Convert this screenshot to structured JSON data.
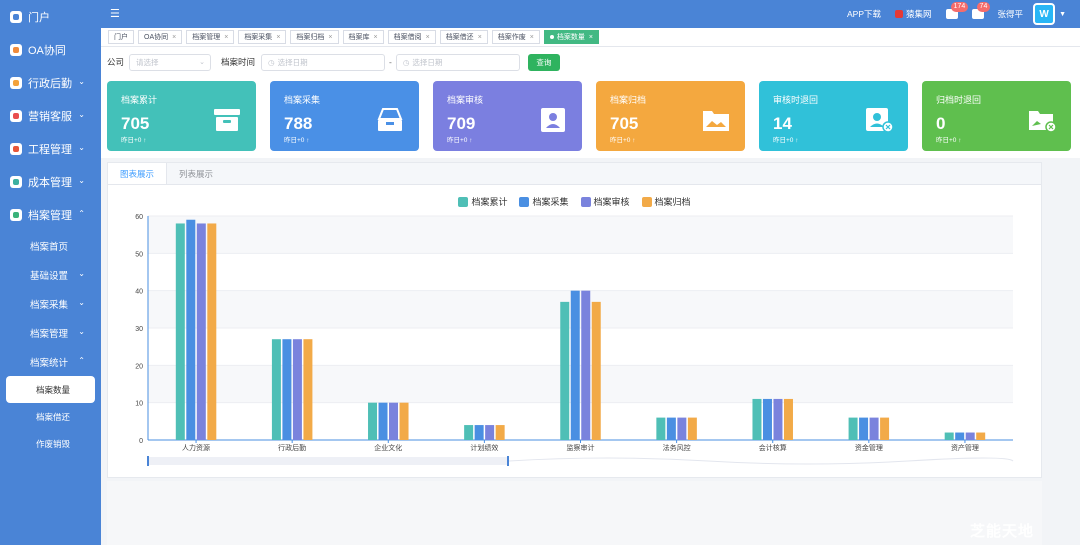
{
  "sidebar": {
    "top_items": [
      {
        "label": "门户",
        "icon": "portal-icon"
      },
      {
        "label": "OA协同",
        "icon": "oa-icon"
      },
      {
        "label": "行政后勤",
        "icon": "admin-icon"
      },
      {
        "label": "营销客服",
        "icon": "marketing-icon"
      },
      {
        "label": "工程管理",
        "icon": "engineering-icon"
      },
      {
        "label": "成本管理",
        "icon": "cost-icon"
      },
      {
        "label": "档案管理",
        "icon": "archive-icon"
      }
    ],
    "archive_sub": [
      {
        "label": "档案首页"
      },
      {
        "label": "基础设置"
      },
      {
        "label": "档案采集"
      },
      {
        "label": "档案管理"
      },
      {
        "label": "档案统计"
      }
    ],
    "stats_sub": [
      {
        "label": "档案数量"
      },
      {
        "label": "档案借还"
      },
      {
        "label": "作废销毁"
      }
    ]
  },
  "topbar": {
    "app_download": "APP下载",
    "collect": "猿集网",
    "msg_badge": "174",
    "user_badge": "74",
    "username": "张得平",
    "avatar_text": "W"
  },
  "tabs": [
    "门户",
    "OA协同",
    "档案管理",
    "档案采集",
    "档案归档",
    "档案库",
    "档案借阅",
    "档案借还",
    "档案作废",
    "档案数量"
  ],
  "filter": {
    "company_label": "公司",
    "company_placeholder": "请选择",
    "time_label": "档案时间",
    "start_placeholder": "选择日期",
    "dash": "-",
    "end_placeholder": "选择日期",
    "query_label": "查询"
  },
  "cards": [
    {
      "title": "档案累计",
      "value": "705",
      "sub": "昨日+0 ↑",
      "color": "#43c1b9"
    },
    {
      "title": "档案采集",
      "value": "788",
      "sub": "昨日+0 ↑",
      "color": "#4a90e6"
    },
    {
      "title": "档案审核",
      "value": "709",
      "sub": "昨日+0 ↑",
      "color": "#7b7fe0"
    },
    {
      "title": "档案归档",
      "value": "705",
      "sub": "昨日+0 ↑",
      "color": "#f4a83f"
    },
    {
      "title": "审核时退回",
      "value": "14",
      "sub": "昨日+0 ↑",
      "color": "#30c1d9"
    },
    {
      "title": "归档时退回",
      "value": "0",
      "sub": "昨日+0 ↑",
      "color": "#5fbf4e"
    }
  ],
  "panel": {
    "tab_chart": "图表展示",
    "tab_list": "列表展示"
  },
  "chart_data": {
    "type": "bar",
    "categories": [
      "人力资源",
      "行政后勤",
      "企业文化",
      "计划绩效",
      "监察审计",
      "法务风控",
      "会计核算",
      "资金管理",
      "资产管理"
    ],
    "series": [
      {
        "name": "档案累计",
        "color": "#4fbfb6",
        "values": [
          58,
          27,
          10,
          4,
          37,
          6,
          11,
          6,
          2
        ]
      },
      {
        "name": "档案采集",
        "color": "#4a8fe2",
        "values": [
          59,
          27,
          10,
          4,
          40,
          6,
          11,
          6,
          2
        ]
      },
      {
        "name": "档案审核",
        "color": "#7a83dd",
        "values": [
          58,
          27,
          10,
          4,
          40,
          6,
          11,
          6,
          2
        ]
      },
      {
        "name": "档案归档",
        "color": "#f2aa48",
        "values": [
          58,
          27,
          10,
          4,
          37,
          6,
          11,
          6,
          2
        ]
      }
    ],
    "ylim": [
      0,
      60
    ],
    "yticks": [
      "0",
      "10",
      "20",
      "30",
      "40",
      "50",
      "60"
    ],
    "grid": true,
    "legend": "top-center"
  },
  "watermark": "芝能天地"
}
